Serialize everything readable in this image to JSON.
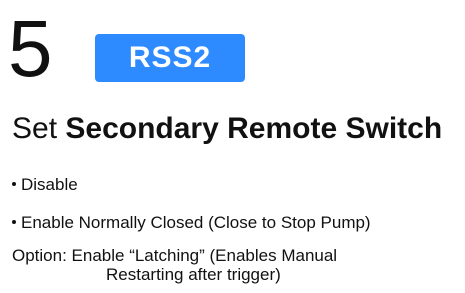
{
  "step": {
    "number": "5",
    "badge": "RSS2"
  },
  "heading": {
    "prefix": "Set ",
    "emphasis": "Secondary Remote Switch"
  },
  "options": {
    "disable": "Disable",
    "enable_nc": "Enable Normally Closed (Close to Stop Pump)",
    "option_line1": "Option: Enable “Latching” (Enables Manual",
    "option_line2": "Restarting after trigger)"
  },
  "colors": {
    "badge_bg": "#2e8bff",
    "badge_text": "#ffffff",
    "text": "#111111"
  },
  "icons": {
    "bullet": "bullet-dot"
  }
}
